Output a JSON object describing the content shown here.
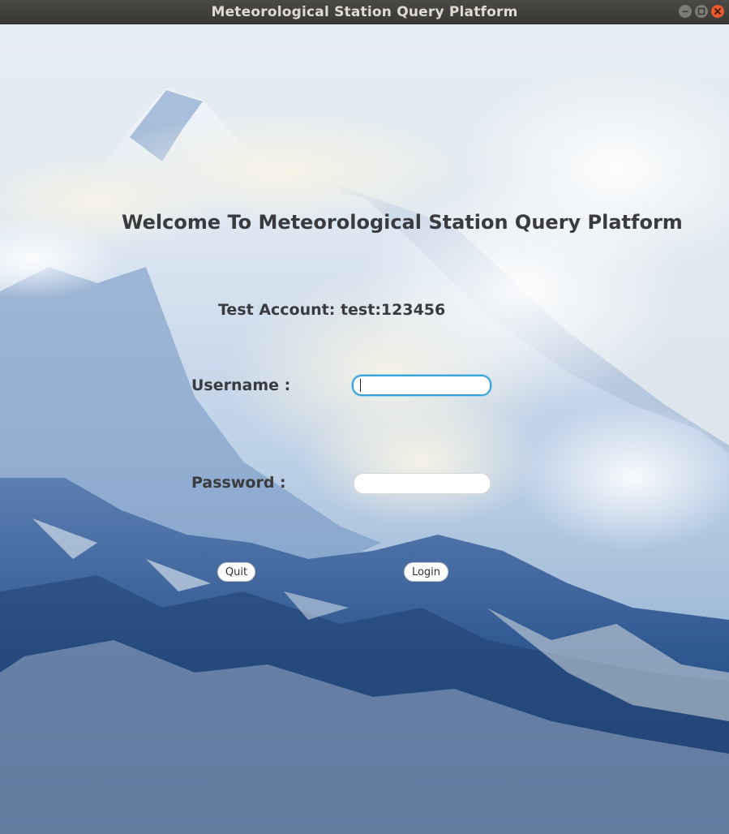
{
  "window": {
    "title": "Meteorological Station Query Platform"
  },
  "login": {
    "heading": "Welcome To Meteorological Station Query Platform",
    "test_account_hint": "Test Account: test:123456",
    "username_label": "Username :",
    "username_value": "",
    "password_label": "Password :",
    "password_value": "",
    "quit_label": "Quit",
    "login_label": "Login"
  },
  "colors": {
    "text": "#3a3b3f",
    "focus_ring": "#3aa3d6",
    "close_button": "#e9592d",
    "titlebar": "#3a3935"
  }
}
